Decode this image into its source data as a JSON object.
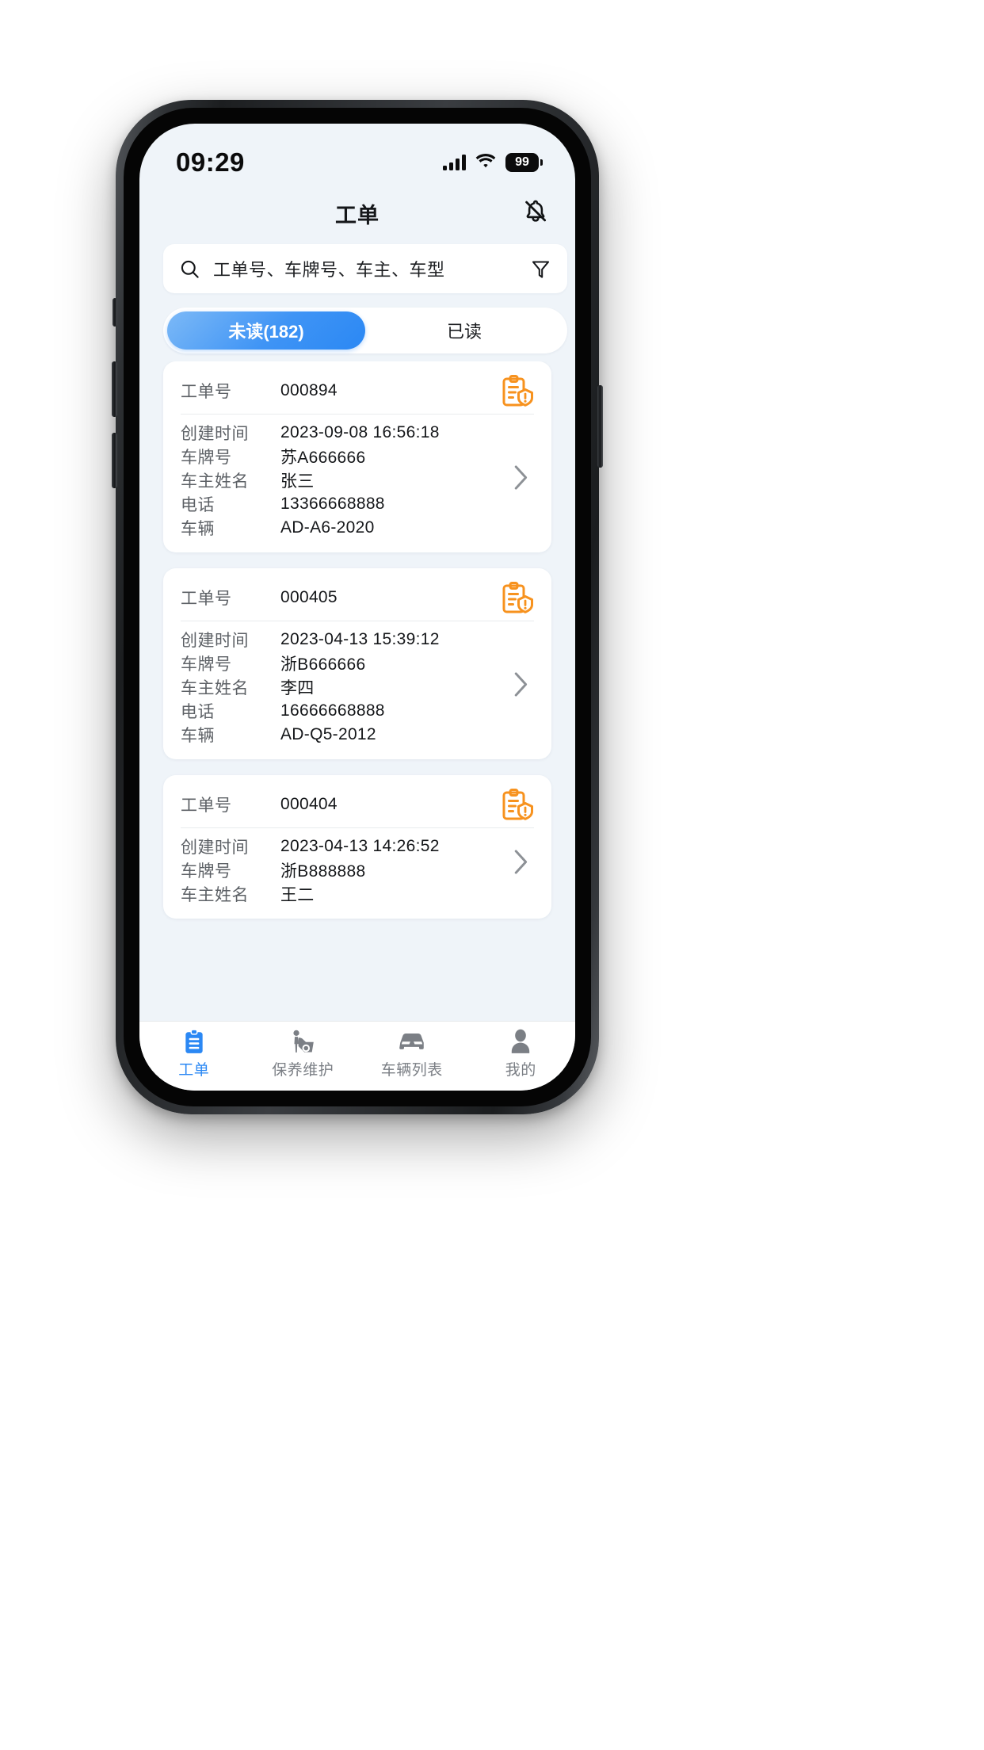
{
  "status_bar": {
    "time": "09:29",
    "battery_level": "99",
    "signal_icon": "cellular-bars-icon",
    "wifi_icon": "wifi-icon",
    "battery_icon": "battery-icon"
  },
  "header": {
    "title": "工单",
    "notification_icon": "bell-off-icon"
  },
  "search": {
    "placeholder": "工单号、车牌号、车主、车型",
    "value": "",
    "search_icon": "search-icon",
    "filter_icon": "filter-icon"
  },
  "tabs": [
    {
      "label": "未读(182)",
      "active": true
    },
    {
      "label": "已读",
      "active": false
    }
  ],
  "field_labels": {
    "order_no": "工单号",
    "created_at": "创建时间",
    "plate_no": "车牌号",
    "owner_name": "车主姓名",
    "phone": "电话",
    "vehicle": "车辆"
  },
  "orders": [
    {
      "order_no": "000894",
      "created_at": "2023-09-08 16:56:18",
      "plate_no": "苏A666666",
      "owner_name": "张三",
      "phone": "13366668888",
      "vehicle": "AD-A6-2020",
      "status_icon": "work-order-alert-icon",
      "chevron_icon": "chevron-right-icon"
    },
    {
      "order_no": "000405",
      "created_at": "2023-04-13 15:39:12",
      "plate_no": "浙B666666",
      "owner_name": "李四",
      "phone": "16666668888",
      "vehicle": "AD-Q5-2012",
      "status_icon": "work-order-alert-icon",
      "chevron_icon": "chevron-right-icon"
    },
    {
      "order_no": "000404",
      "created_at": "2023-04-13 14:26:52",
      "plate_no": "浙B888888",
      "owner_name": "王二",
      "phone": "",
      "vehicle": "",
      "status_icon": "work-order-alert-icon",
      "chevron_icon": "chevron-right-icon"
    }
  ],
  "bottom_nav": [
    {
      "label": "工单",
      "icon": "clipboard-icon",
      "active": true
    },
    {
      "label": "保养维护",
      "icon": "mechanic-icon",
      "active": false
    },
    {
      "label": "车辆列表",
      "icon": "car-icon",
      "active": false
    },
    {
      "label": "我的",
      "icon": "user-icon",
      "active": false
    }
  ],
  "colors": {
    "accent": "#2b88f4",
    "status_icon": "#f7921e",
    "screen_bg": "#eff4f9",
    "card_bg": "#ffffff",
    "label_text": "#5d6166",
    "value_text": "#15171a"
  }
}
